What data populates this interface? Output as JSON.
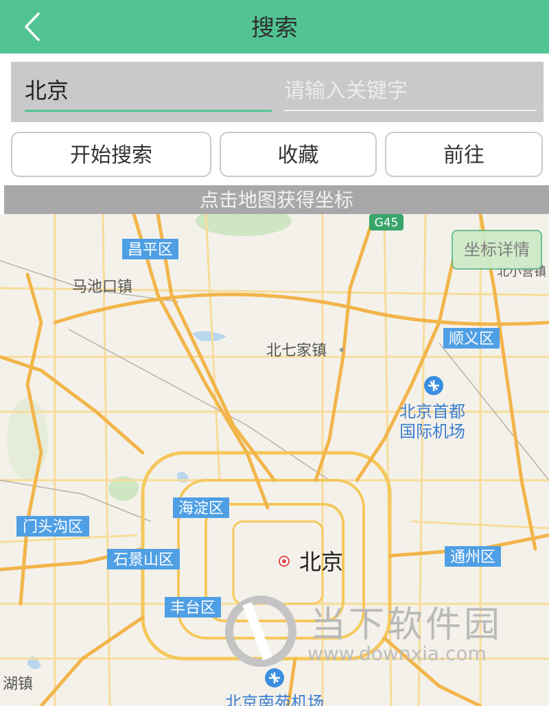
{
  "header": {
    "title": "搜索",
    "back_icon": "chevron-left-icon"
  },
  "search": {
    "city_value": "北京",
    "keyword_placeholder": "请输入关键字"
  },
  "buttons": {
    "start_search": "开始搜索",
    "favorite": "收藏",
    "go": "前往"
  },
  "map_hint": "点击地图获得坐标",
  "map": {
    "highway_badge": "G45",
    "coord_detail_button": "坐标详情",
    "labels": {
      "changping": "昌平区",
      "machikou": "马池口镇",
      "beiqijia": "北七家镇",
      "shunyi": "顺义区",
      "airport_line1": "北京首都",
      "airport_line2": "国际机场",
      "haidian": "海淀区",
      "mentougou": "门头沟区",
      "shijingshan": "石景山区",
      "beijing": "北京",
      "tongzhou": "通州区",
      "fengtai": "丰台区",
      "nanyuan_airport": "北京南苑机场",
      "hu_town": "湖镇",
      "beixiaoying": "北小营镇"
    },
    "colors": {
      "land": "#f4f1ea",
      "major_road": "#f2b54a",
      "minor_road": "#f7dc9a",
      "district_label_bg": "#4f9fe4",
      "green": "#cfe6c3",
      "water": "#b9d6ef"
    }
  },
  "watermark": {
    "brand": "当下软件园",
    "url": "www.downxia.com"
  }
}
